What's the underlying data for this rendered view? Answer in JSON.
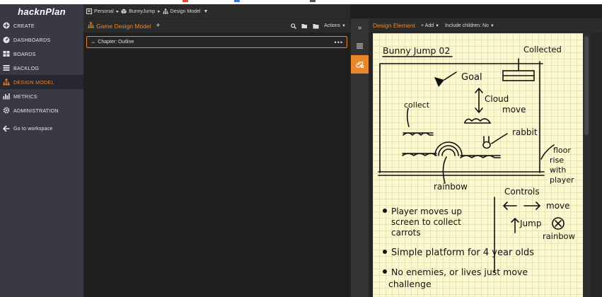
{
  "app": {
    "logo": "hacknPlan"
  },
  "sidebar": {
    "items": [
      {
        "label": "CREATE",
        "icon": "plus-circle-icon"
      },
      {
        "label": "DASHBOARDS",
        "icon": "dashboard-icon"
      },
      {
        "label": "BOARDS",
        "icon": "boards-icon"
      },
      {
        "label": "BACKLOG",
        "icon": "list-icon"
      },
      {
        "label": "DESIGN MODEL",
        "icon": "hierarchy-icon"
      },
      {
        "label": "METRICS",
        "icon": "bar-chart-icon"
      },
      {
        "label": "ADMINISTRATION",
        "icon": "gear-icon"
      }
    ],
    "workspace_label": "Go to workspace"
  },
  "breadcrumb": {
    "workspace": "Personal",
    "project": "BunnyJump",
    "section": "Design Model"
  },
  "gdm": {
    "title": "Game Design Model",
    "actions_label": "Actions",
    "chapter_label": "Chapter: Outline"
  },
  "design_element": {
    "title": "Design Element",
    "add_label": "Add",
    "include_children_label": "Include children: No"
  },
  "sketch": {
    "title": "Bunny Jump 02",
    "labels": {
      "collected": "Collected",
      "goal": "Goal",
      "cloud": "Cloud",
      "move": "move",
      "collect": "collect",
      "rabbit": "rabbit",
      "floor1": "floor",
      "floor2": "rise",
      "floor3": "with",
      "floor4": "player",
      "rainbow": "rainbow",
      "controls": "Controls",
      "ctrl_move": "move",
      "jump": "Jump",
      "ctrl_rainbow": "rainbow"
    },
    "bullets": {
      "b1_l1": "Player moves up",
      "b1_l2": "screen to collect",
      "b1_l3": "carrots",
      "b2": "Simple platform for 4 year olds",
      "b3_l1": "No enemies, or lives just move",
      "b3_l2": "challenge"
    }
  },
  "colors": {
    "accent": "#e8872b",
    "sidebar": "#393946",
    "paper": "#fdf8d0"
  }
}
